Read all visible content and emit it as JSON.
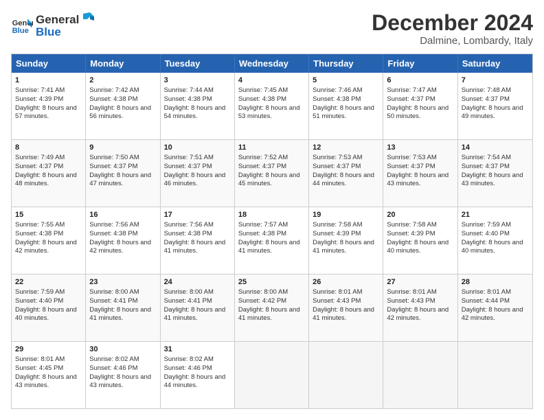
{
  "header": {
    "logo_line1": "General",
    "logo_line2": "Blue",
    "month_title": "December 2024",
    "location": "Dalmine, Lombardy, Italy"
  },
  "weekdays": [
    "Sunday",
    "Monday",
    "Tuesday",
    "Wednesday",
    "Thursday",
    "Friday",
    "Saturday"
  ],
  "rows": [
    [
      {
        "day": "1",
        "sunrise": "Sunrise: 7:41 AM",
        "sunset": "Sunset: 4:39 PM",
        "daylight": "Daylight: 8 hours and 57 minutes."
      },
      {
        "day": "2",
        "sunrise": "Sunrise: 7:42 AM",
        "sunset": "Sunset: 4:38 PM",
        "daylight": "Daylight: 8 hours and 56 minutes."
      },
      {
        "day": "3",
        "sunrise": "Sunrise: 7:44 AM",
        "sunset": "Sunset: 4:38 PM",
        "daylight": "Daylight: 8 hours and 54 minutes."
      },
      {
        "day": "4",
        "sunrise": "Sunrise: 7:45 AM",
        "sunset": "Sunset: 4:38 PM",
        "daylight": "Daylight: 8 hours and 53 minutes."
      },
      {
        "day": "5",
        "sunrise": "Sunrise: 7:46 AM",
        "sunset": "Sunset: 4:38 PM",
        "daylight": "Daylight: 8 hours and 51 minutes."
      },
      {
        "day": "6",
        "sunrise": "Sunrise: 7:47 AM",
        "sunset": "Sunset: 4:37 PM",
        "daylight": "Daylight: 8 hours and 50 minutes."
      },
      {
        "day": "7",
        "sunrise": "Sunrise: 7:48 AM",
        "sunset": "Sunset: 4:37 PM",
        "daylight": "Daylight: 8 hours and 49 minutes."
      }
    ],
    [
      {
        "day": "8",
        "sunrise": "Sunrise: 7:49 AM",
        "sunset": "Sunset: 4:37 PM",
        "daylight": "Daylight: 8 hours and 48 minutes."
      },
      {
        "day": "9",
        "sunrise": "Sunrise: 7:50 AM",
        "sunset": "Sunset: 4:37 PM",
        "daylight": "Daylight: 8 hours and 47 minutes."
      },
      {
        "day": "10",
        "sunrise": "Sunrise: 7:51 AM",
        "sunset": "Sunset: 4:37 PM",
        "daylight": "Daylight: 8 hours and 46 minutes."
      },
      {
        "day": "11",
        "sunrise": "Sunrise: 7:52 AM",
        "sunset": "Sunset: 4:37 PM",
        "daylight": "Daylight: 8 hours and 45 minutes."
      },
      {
        "day": "12",
        "sunrise": "Sunrise: 7:53 AM",
        "sunset": "Sunset: 4:37 PM",
        "daylight": "Daylight: 8 hours and 44 minutes."
      },
      {
        "day": "13",
        "sunrise": "Sunrise: 7:53 AM",
        "sunset": "Sunset: 4:37 PM",
        "daylight": "Daylight: 8 hours and 43 minutes."
      },
      {
        "day": "14",
        "sunrise": "Sunrise: 7:54 AM",
        "sunset": "Sunset: 4:37 PM",
        "daylight": "Daylight: 8 hours and 43 minutes."
      }
    ],
    [
      {
        "day": "15",
        "sunrise": "Sunrise: 7:55 AM",
        "sunset": "Sunset: 4:38 PM",
        "daylight": "Daylight: 8 hours and 42 minutes."
      },
      {
        "day": "16",
        "sunrise": "Sunrise: 7:56 AM",
        "sunset": "Sunset: 4:38 PM",
        "daylight": "Daylight: 8 hours and 42 minutes."
      },
      {
        "day": "17",
        "sunrise": "Sunrise: 7:56 AM",
        "sunset": "Sunset: 4:38 PM",
        "daylight": "Daylight: 8 hours and 41 minutes."
      },
      {
        "day": "18",
        "sunrise": "Sunrise: 7:57 AM",
        "sunset": "Sunset: 4:38 PM",
        "daylight": "Daylight: 8 hours and 41 minutes."
      },
      {
        "day": "19",
        "sunrise": "Sunrise: 7:58 AM",
        "sunset": "Sunset: 4:39 PM",
        "daylight": "Daylight: 8 hours and 41 minutes."
      },
      {
        "day": "20",
        "sunrise": "Sunrise: 7:58 AM",
        "sunset": "Sunset: 4:39 PM",
        "daylight": "Daylight: 8 hours and 40 minutes."
      },
      {
        "day": "21",
        "sunrise": "Sunrise: 7:59 AM",
        "sunset": "Sunset: 4:40 PM",
        "daylight": "Daylight: 8 hours and 40 minutes."
      }
    ],
    [
      {
        "day": "22",
        "sunrise": "Sunrise: 7:59 AM",
        "sunset": "Sunset: 4:40 PM",
        "daylight": "Daylight: 8 hours and 40 minutes."
      },
      {
        "day": "23",
        "sunrise": "Sunrise: 8:00 AM",
        "sunset": "Sunset: 4:41 PM",
        "daylight": "Daylight: 8 hours and 41 minutes."
      },
      {
        "day": "24",
        "sunrise": "Sunrise: 8:00 AM",
        "sunset": "Sunset: 4:41 PM",
        "daylight": "Daylight: 8 hours and 41 minutes."
      },
      {
        "day": "25",
        "sunrise": "Sunrise: 8:00 AM",
        "sunset": "Sunset: 4:42 PM",
        "daylight": "Daylight: 8 hours and 41 minutes."
      },
      {
        "day": "26",
        "sunrise": "Sunrise: 8:01 AM",
        "sunset": "Sunset: 4:43 PM",
        "daylight": "Daylight: 8 hours and 41 minutes."
      },
      {
        "day": "27",
        "sunrise": "Sunrise: 8:01 AM",
        "sunset": "Sunset: 4:43 PM",
        "daylight": "Daylight: 8 hours and 42 minutes."
      },
      {
        "day": "28",
        "sunrise": "Sunrise: 8:01 AM",
        "sunset": "Sunset: 4:44 PM",
        "daylight": "Daylight: 8 hours and 42 minutes."
      }
    ],
    [
      {
        "day": "29",
        "sunrise": "Sunrise: 8:01 AM",
        "sunset": "Sunset: 4:45 PM",
        "daylight": "Daylight: 8 hours and 43 minutes."
      },
      {
        "day": "30",
        "sunrise": "Sunrise: 8:02 AM",
        "sunset": "Sunset: 4:46 PM",
        "daylight": "Daylight: 8 hours and 43 minutes."
      },
      {
        "day": "31",
        "sunrise": "Sunrise: 8:02 AM",
        "sunset": "Sunset: 4:46 PM",
        "daylight": "Daylight: 8 hours and 44 minutes."
      },
      {
        "day": "",
        "sunrise": "",
        "sunset": "",
        "daylight": ""
      },
      {
        "day": "",
        "sunrise": "",
        "sunset": "",
        "daylight": ""
      },
      {
        "day": "",
        "sunrise": "",
        "sunset": "",
        "daylight": ""
      },
      {
        "day": "",
        "sunrise": "",
        "sunset": "",
        "daylight": ""
      }
    ]
  ]
}
